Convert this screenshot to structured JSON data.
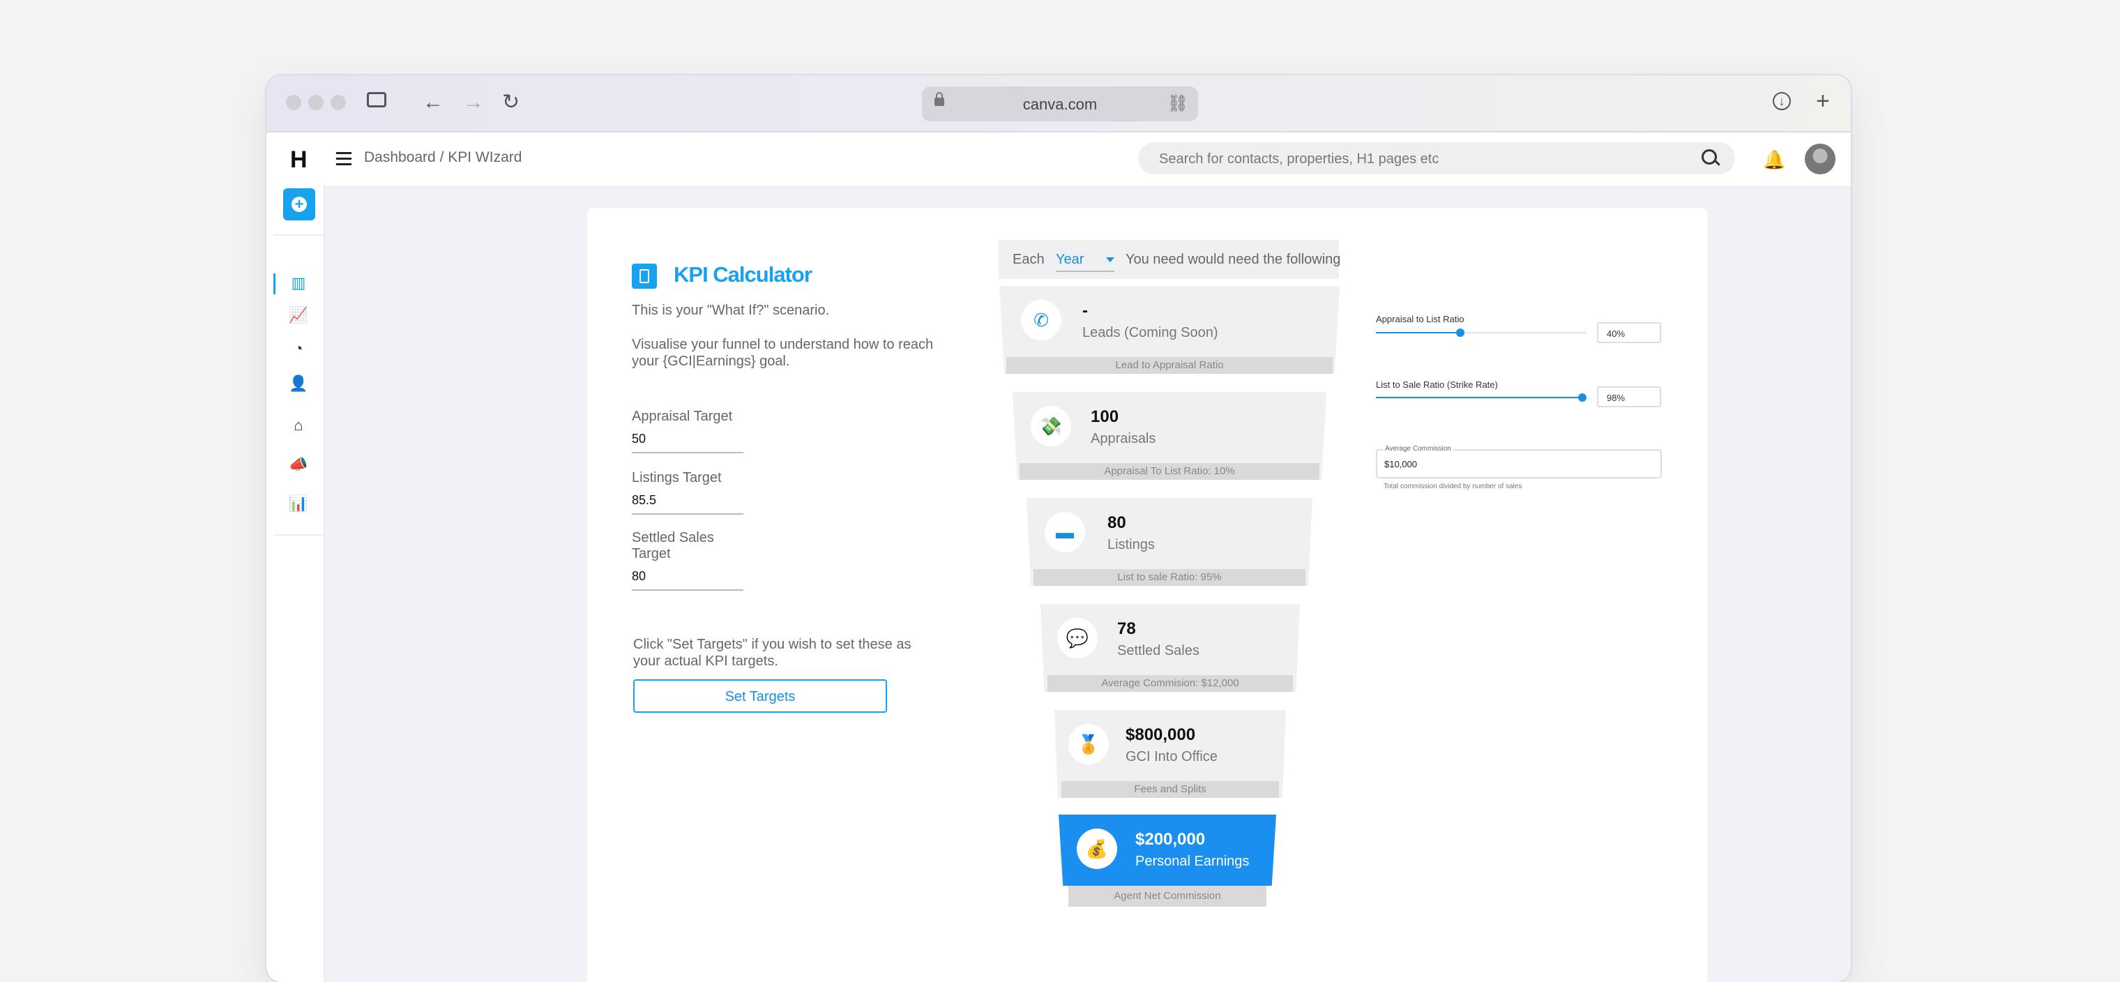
{
  "browser": {
    "url": "canva.com"
  },
  "app": {
    "logo": "H",
    "breadcrumb": "Dashboard / KPI WIzard",
    "search_placeholder": "Search for contacts, properties, H1 pages etc"
  },
  "calculator": {
    "title": "KPI Calculator",
    "intro": "This is your \"What If?\" scenario.",
    "description": "Visualise your funnel to understand how to reach your {GCI|Earnings} goal.",
    "fields": [
      {
        "label": "Appraisal Target",
        "value": "50"
      },
      {
        "label": "Listings Target",
        "value": "85.5"
      },
      {
        "label": "Settled Sales Target",
        "value": "80"
      }
    ],
    "note": "Click \"Set Targets\" if you wish to set these as your actual KPI targets.",
    "button": "Set Targets"
  },
  "funnel": {
    "each_label": "Each",
    "period": "Year",
    "need_text": "You need would need the following",
    "stages": [
      {
        "value": "-",
        "name": "Leads (Coming Soon)",
        "footer": "Lead to Appraisal Ratio",
        "icon": "phone-icon"
      },
      {
        "value": "100",
        "name": "Appraisals",
        "footer": "Appraisal To List Ratio: 10%",
        "icon": "hand-coin-icon"
      },
      {
        "value": "80",
        "name": "Listings",
        "footer": "List to sale Ratio: 95%",
        "icon": "listing-card-icon"
      },
      {
        "value": "78",
        "name": "Settled Sales",
        "footer": "Average Commision: $12,000",
        "icon": "chat-dollar-icon"
      },
      {
        "value": "$800,000",
        "name": "GCI Into Office",
        "footer": "Fees and Splits",
        "icon": "medal-icon"
      },
      {
        "value": "$200,000",
        "name": "Personal Earnings",
        "footer": "Agent Net Commission",
        "icon": "money-bag-icon"
      }
    ]
  },
  "controls": {
    "appraisal_ratio": {
      "label": "Appraisal to List Ratio",
      "value": "40%",
      "level": 0.4
    },
    "strike_rate": {
      "label": "List to Sale Ratio (Strike Rate)",
      "value": "98%",
      "level": 0.98
    },
    "commission": {
      "label": "Average Commission",
      "value": "$10,000",
      "hint": "Total commission divided by number of sales"
    }
  },
  "colors": {
    "accent": "#17a2f0",
    "highlight_stage": "#1a8ff0"
  }
}
